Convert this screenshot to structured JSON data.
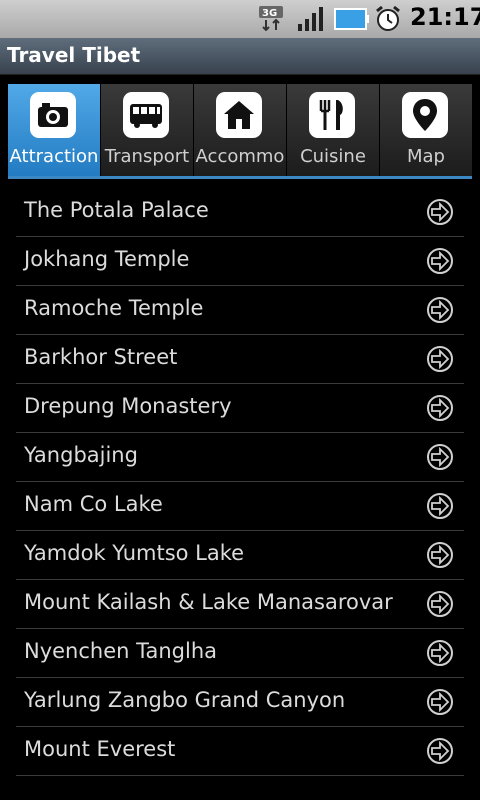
{
  "status_bar": {
    "network": "3G",
    "time": "21:17",
    "icons": [
      "3g-icon",
      "signal-icon",
      "battery-icon",
      "alarm-icon"
    ]
  },
  "app": {
    "title": "Travel Tibet"
  },
  "tabs": [
    {
      "label": "Attraction",
      "icon": "camera-icon",
      "active": true
    },
    {
      "label": "Transport",
      "icon": "bus-icon",
      "active": false
    },
    {
      "label": "Accommo",
      "icon": "house-icon",
      "active": false
    },
    {
      "label": "Cuisine",
      "icon": "cutlery-icon",
      "active": false
    },
    {
      "label": "Map",
      "icon": "map-pin-icon",
      "active": false
    }
  ],
  "attractions": [
    "The Potala Palace",
    "Jokhang Temple",
    "Ramoche Temple",
    "Barkhor Street",
    "Drepung Monastery",
    "Yangbajing",
    "Nam Co Lake",
    "Yamdok Yumtso Lake",
    "Mount Kailash & Lake Manasarovar",
    "Nyenchen Tanglha",
    "Yarlung Zangbo Grand Canyon",
    "Mount Everest"
  ],
  "colors": {
    "active_tab": "#3a93d8",
    "title_bar": "#4a5664",
    "accent_line": "#3b88c4"
  }
}
